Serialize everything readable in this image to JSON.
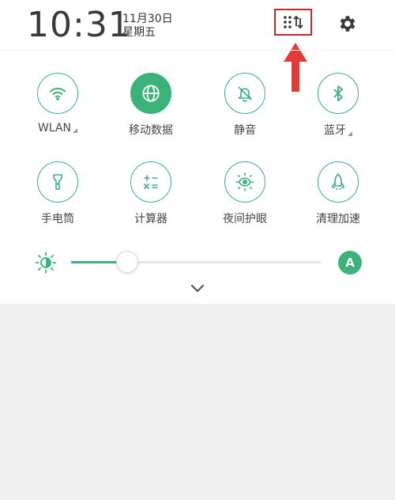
{
  "status": {
    "time": "10:31",
    "date": "11月30日",
    "weekday": "星期五"
  },
  "tiles": [
    {
      "label": "WLAN",
      "icon": "wifi-icon",
      "active": false,
      "expandable": true
    },
    {
      "label": "移动数据",
      "icon": "globe-icon",
      "active": true,
      "expandable": false
    },
    {
      "label": "静音",
      "icon": "bell-off-icon",
      "active": false,
      "expandable": false
    },
    {
      "label": "蓝牙",
      "icon": "bluetooth-icon",
      "active": false,
      "expandable": true
    },
    {
      "label": "手电筒",
      "icon": "flashlight-icon",
      "active": false,
      "expandable": false
    },
    {
      "label": "计算器",
      "icon": "calculator-icon",
      "active": false,
      "expandable": false
    },
    {
      "label": "夜间护眼",
      "icon": "eye-icon",
      "active": false,
      "expandable": false
    },
    {
      "label": "清理加速",
      "icon": "rocket-icon",
      "active": false,
      "expandable": false
    }
  ],
  "brightness": {
    "level": 0.22,
    "auto_label": "A"
  },
  "colors": {
    "accent": "#3ab37a",
    "highlight": "#c62828",
    "arrow": "#e53935"
  }
}
